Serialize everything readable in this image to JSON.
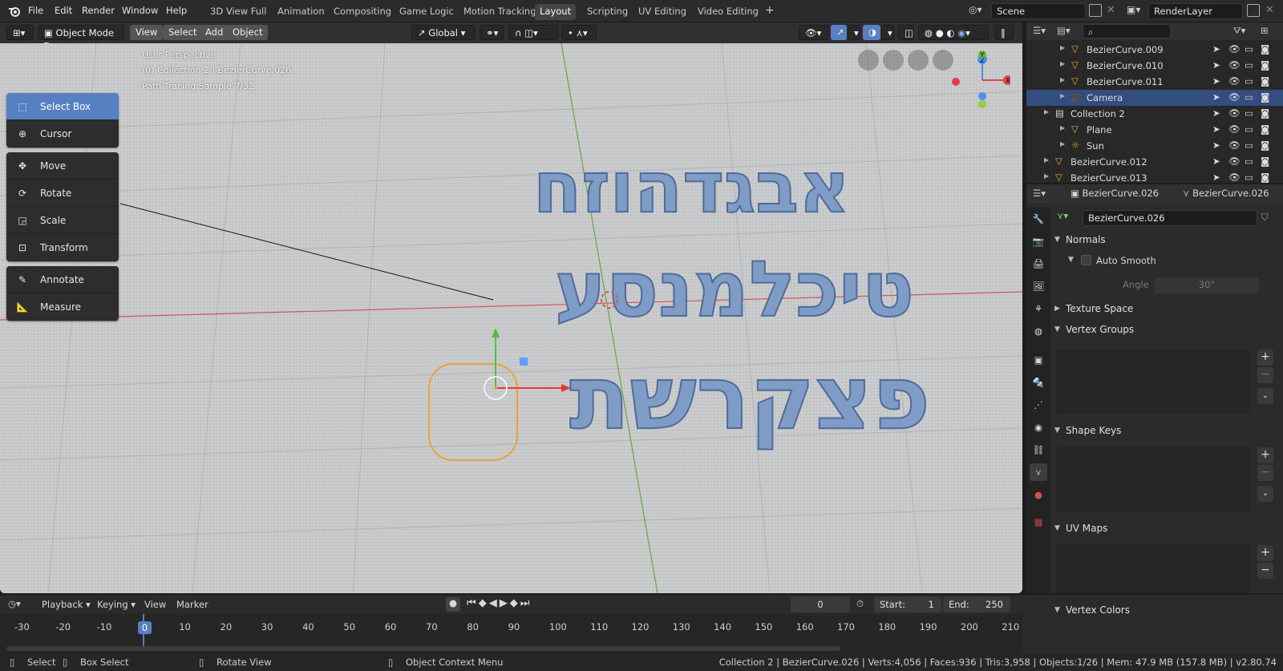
{
  "menu": [
    "File",
    "Edit",
    "Render",
    "Window",
    "Help"
  ],
  "workspaces": [
    "3D View Full",
    "Animation",
    "Compositing",
    "Game Logic",
    "Motion Tracking",
    "Layout",
    "Scripting",
    "UV Editing",
    "Video Editing"
  ],
  "active_workspace": "Layout",
  "scene_name": "Scene",
  "render_layer": "RenderLayer",
  "viewport_header": {
    "mode": "Object Mode",
    "menus": [
      "View",
      "Select",
      "Add",
      "Object"
    ],
    "orientation": "Global"
  },
  "overlay": {
    "perspective": "User Perspective",
    "collection": "(0) Collection 2 | BezierCurve.026",
    "sample": "Path Tracing Sample 7/32"
  },
  "tools": {
    "group1": [
      "Select Box",
      "Cursor"
    ],
    "group2": [
      "Move",
      "Rotate",
      "Scale",
      "Transform"
    ],
    "group3": [
      "Annotate",
      "Measure"
    ]
  },
  "scene_text": {
    "row1": "אבגדהוזח",
    "row2": "טיכלמנסע",
    "row3": "פצקרשת"
  },
  "gizmo": {
    "x": "X",
    "y": "Y",
    "z": "Z"
  },
  "outliner": [
    {
      "name": "BezierCurve.009",
      "indent": 2,
      "kind": "curve"
    },
    {
      "name": "BezierCurve.010",
      "indent": 2,
      "kind": "curve"
    },
    {
      "name": "BezierCurve.011",
      "indent": 2,
      "kind": "curve"
    },
    {
      "name": "Camera",
      "indent": 2,
      "kind": "camera",
      "selected": true
    },
    {
      "name": "Collection 2",
      "indent": 1,
      "kind": "collection"
    },
    {
      "name": "Plane",
      "indent": 2,
      "kind": "mesh"
    },
    {
      "name": "Sun",
      "indent": 2,
      "kind": "light"
    },
    {
      "name": "BezierCurve.012",
      "indent": 1,
      "kind": "curve"
    },
    {
      "name": "BezierCurve.013",
      "indent": 1,
      "kind": "curve"
    }
  ],
  "properties": {
    "object_name": "BezierCurve.026",
    "data_name": "BezierCurve.026",
    "datablock": "BezierCurve.026",
    "sections": {
      "normals": "Normals",
      "auto_smooth": "Auto Smooth",
      "angle_label": "Angle",
      "angle_value": "30°",
      "texture_space": "Texture Space",
      "vertex_groups": "Vertex Groups",
      "shape_keys": "Shape Keys",
      "uv_maps": "UV Maps",
      "vertex_colors": "Vertex Colors"
    }
  },
  "timeline": {
    "menus": [
      "Playback",
      "Keying",
      "View",
      "Marker"
    ],
    "current_frame": "0",
    "start_label": "Start:",
    "start": "1",
    "end_label": "End:",
    "end": "250",
    "ticks": [
      "-30",
      "-20",
      "-10",
      "0",
      "10",
      "20",
      "30",
      "40",
      "50",
      "60",
      "70",
      "80",
      "90",
      "100",
      "110",
      "120",
      "130",
      "140",
      "150",
      "160",
      "170",
      "180",
      "190",
      "200",
      "210"
    ]
  },
  "status": {
    "select": "Select",
    "box_select": "Box Select",
    "rotate_view": "Rotate View",
    "context_menu": "Object Context Menu",
    "stats": "Collection 2 | BezierCurve.026 | Verts:4,056 | Faces:936 | Tris:3,958 | Objects:1/26 | Mem: 47.9 MB (157.8 MB) | v2.80.74"
  },
  "colors": {
    "accent": "#5680c2",
    "selected_row": "#334d80",
    "orange": "#e8a33a",
    "letter": "#7f9cc7"
  }
}
